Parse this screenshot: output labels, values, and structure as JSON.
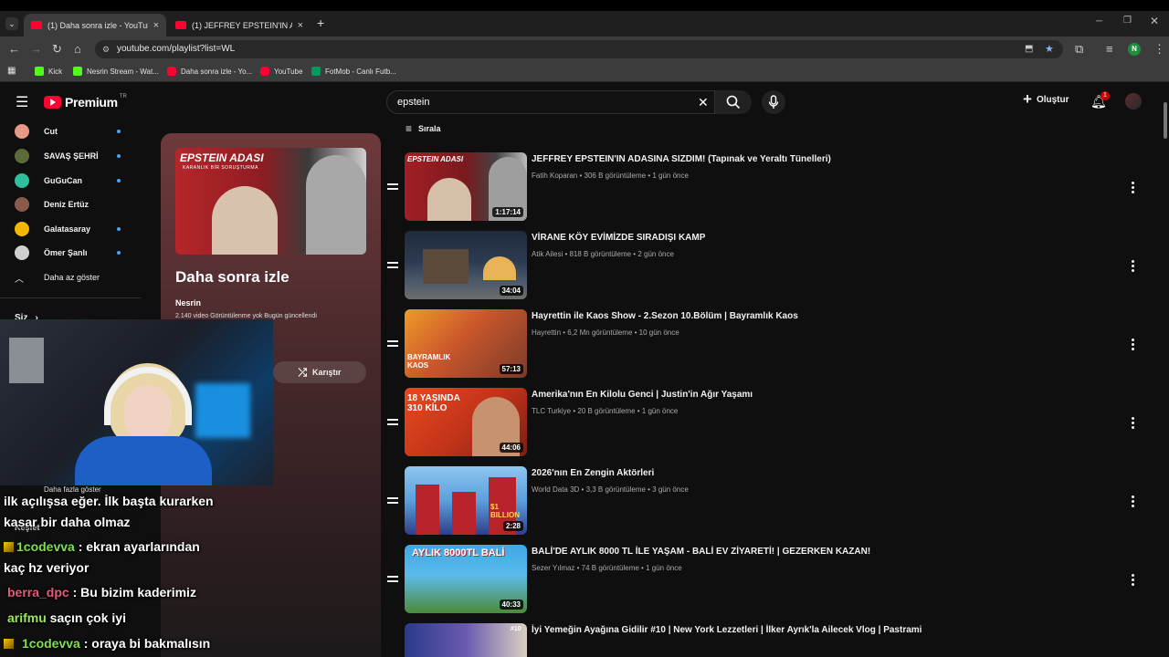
{
  "browser": {
    "tabs": [
      {
        "title": "(1) Daha sonra izle - YouTube",
        "close": "×"
      },
      {
        "title": "(1) JEFFREY EPSTEIN'IN ADASIN",
        "close": "×"
      }
    ],
    "new_tab": "+",
    "url": "youtube.com/playlist?list=WL",
    "bookmarks": [
      "Kick",
      "Nesrin Stream - Wat...",
      "Daha sonra izle - Yo...",
      "YouTube",
      "FotMob - Canlı Futb..."
    ],
    "profile_initial": "N"
  },
  "youtube": {
    "logo": "Premium",
    "logo_sup": "TR",
    "search_value": "epstein",
    "create_label": "Oluştur",
    "notification_count": "1",
    "sort_label": "Sırala",
    "sidebar": {
      "subscriptions": [
        "Cut",
        "SAVAŞ ŞEHRİ",
        "GuGuCan",
        "Deniz Ertüz",
        "Galatasaray",
        "Ömer Şanlı"
      ],
      "show_less": "Daha az göster",
      "you_label": "Siz",
      "show_more": "Daha fazla göster",
      "explore": "Keşfet"
    },
    "playlist": {
      "thumb_text": "EPSTEIN ADASI",
      "thumb_sub": "KARANLIK BİR SORUŞTURMA",
      "title": "Daha sonra izle",
      "owner": "Nesrin",
      "stats": "2.140 video   Görüntülenme yok   Bugün güncellendi",
      "shuffle": "Karıştır"
    },
    "videos": [
      {
        "title": "JEFFREY EPSTEIN'IN ADASINA SIZDIM! (Tapınak ve Yeraltı Tünelleri)",
        "meta": "Fatih Koparan • 306 B görüntüleme • 1 gün önce",
        "duration": "1:17:14",
        "thumb_text": "EPSTEIN ADASI"
      },
      {
        "title": "VİRANE KÖY EVİMİZDE SIRADIŞI KAMP",
        "meta": "Atik Ailesi • 818 B görüntüleme • 2 gün önce",
        "duration": "34:04",
        "thumb_text": ""
      },
      {
        "title": "Hayrettin ile Kaos Show - 2.Sezon 10.Bölüm | Bayramlık Kaos",
        "meta": "Hayrettin • 6,2 Mn görüntüleme • 10 gün önce",
        "duration": "57:13",
        "thumb_text": "BAYRAMLIK KAOS"
      },
      {
        "title": "Amerika'nın En Kilolu Genci | Justin'in Ağır Yaşamı",
        "meta": "TLC Turkiye • 20 B görüntüleme • 1 gün önce",
        "duration": "44:06",
        "thumb_text": "18 YAŞINDA 310 KİLO"
      },
      {
        "title": "2026'nın En Zengin Aktörleri",
        "meta": "World Data 3D • 3,3 B görüntüleme • 3 gün önce",
        "duration": "2:28",
        "thumb_text": "$1 BILLION"
      },
      {
        "title": "BALİ'DE AYLIK 8000 TL İLE YAŞAM - BALİ EV ZİYARETİ! | GEZERKEN KAZAN!",
        "meta": "Sezer Yılmaz • 74 B görüntüleme • 1 gün önce",
        "duration": "40:33",
        "thumb_text": "AYLIK 8000TL BALİ"
      },
      {
        "title": "İyi Yemeğin Ayağına Gidilir #10 | New York Lezzetleri | İlker Ayrık'la Ailecek Vlog | Pastrami",
        "meta": "",
        "duration": "",
        "thumb_text": "#10"
      }
    ]
  },
  "chat": [
    {
      "user": "",
      "text": "ilk açılışsa eğer. İlk başta kurarken"
    },
    {
      "user": "",
      "text": "kasar bir daha olmaz"
    },
    {
      "user": "1codevva",
      "text": " : ekran ayarlarından"
    },
    {
      "user": "",
      "text": "kaç hz veriyor"
    },
    {
      "user": "berra_dpc",
      "text": " : Bu bizim kaderimiz"
    },
    {
      "user": "arifmu",
      "text": " saçın çok iyi"
    },
    {
      "user": "1codevva",
      "text": " : oraya bi bakmalısın"
    }
  ],
  "colors": {
    "accent": "#ff0033",
    "link": "#3ea6ff",
    "bg": "#0f0f0f"
  }
}
